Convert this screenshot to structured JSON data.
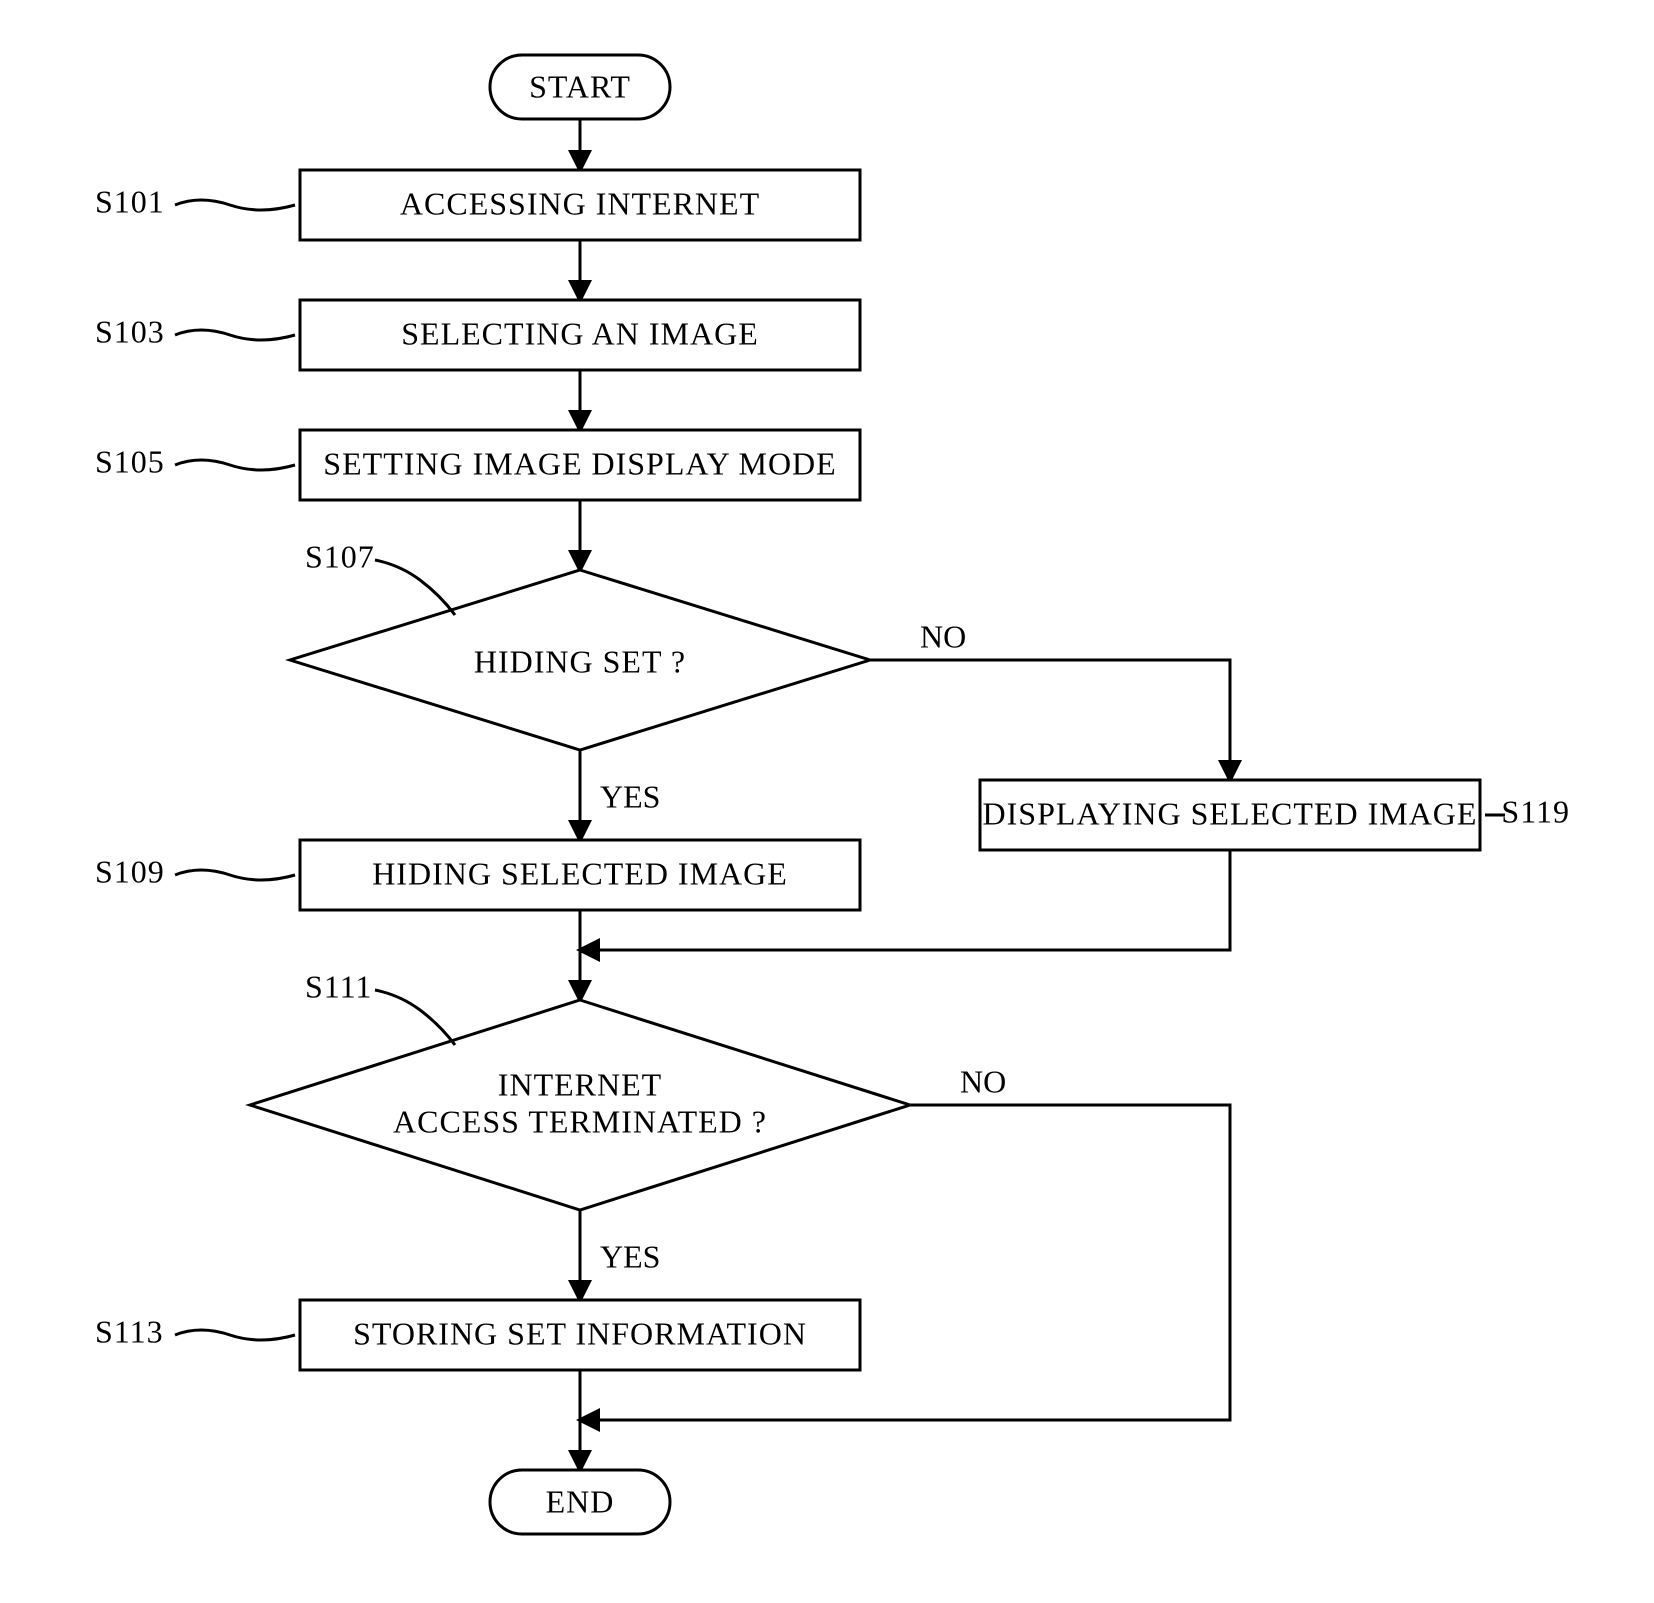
{
  "chart_data": {
    "type": "flowchart",
    "title": "",
    "nodes": [
      {
        "id": "start",
        "shape": "terminator",
        "text": "START"
      },
      {
        "id": "s101",
        "shape": "process",
        "text": "ACCESSING INTERNET",
        "ref": "S101"
      },
      {
        "id": "s103",
        "shape": "process",
        "text": "SELECTING AN IMAGE",
        "ref": "S103"
      },
      {
        "id": "s105",
        "shape": "process",
        "text": "SETTING IMAGE DISPLAY MODE",
        "ref": "S105"
      },
      {
        "id": "s107",
        "shape": "decision",
        "text": "HIDING SET ?",
        "ref": "S107"
      },
      {
        "id": "s109",
        "shape": "process",
        "text": "HIDING SELECTED IMAGE",
        "ref": "S109"
      },
      {
        "id": "s119",
        "shape": "process",
        "text": "DISPLAYING SELECTED IMAGE",
        "ref": "S119"
      },
      {
        "id": "s111",
        "shape": "decision",
        "text": "INTERNET\nACCESS TERMINATED ?",
        "ref": "S111"
      },
      {
        "id": "s113",
        "shape": "process",
        "text": "STORING SET INFORMATION",
        "ref": "S113"
      },
      {
        "id": "end",
        "shape": "terminator",
        "text": "END"
      }
    ],
    "edges": [
      {
        "from": "start",
        "to": "s101"
      },
      {
        "from": "s101",
        "to": "s103"
      },
      {
        "from": "s103",
        "to": "s105"
      },
      {
        "from": "s105",
        "to": "s107"
      },
      {
        "from": "s107",
        "to": "s109",
        "label": "YES"
      },
      {
        "from": "s107",
        "to": "s119",
        "label": "NO"
      },
      {
        "from": "s109",
        "to": "s111"
      },
      {
        "from": "s119",
        "to": "s111-merge"
      },
      {
        "from": "s111",
        "to": "s113",
        "label": "YES"
      },
      {
        "from": "s111",
        "to": "end-merge",
        "label": "NO"
      },
      {
        "from": "s113",
        "to": "end"
      }
    ]
  },
  "labels": {
    "start": "START",
    "end": "END",
    "s101": "ACCESSING INTERNET",
    "s103": "SELECTING AN IMAGE",
    "s105": "SETTING IMAGE DISPLAY MODE",
    "s107": "HIDING SET ?",
    "s109": "HIDING SELECTED IMAGE",
    "s119": "DISPLAYING SELECTED IMAGE",
    "s111a": "INTERNET",
    "s111b": "ACCESS TERMINATED ?",
    "s113": "STORING SET INFORMATION"
  },
  "refs": {
    "s101": "S101",
    "s103": "S103",
    "s105": "S105",
    "s107": "S107",
    "s109": "S109",
    "s111": "S111",
    "s113": "S113",
    "s119": "S119"
  },
  "branches": {
    "yes": "YES",
    "no": "NO"
  }
}
